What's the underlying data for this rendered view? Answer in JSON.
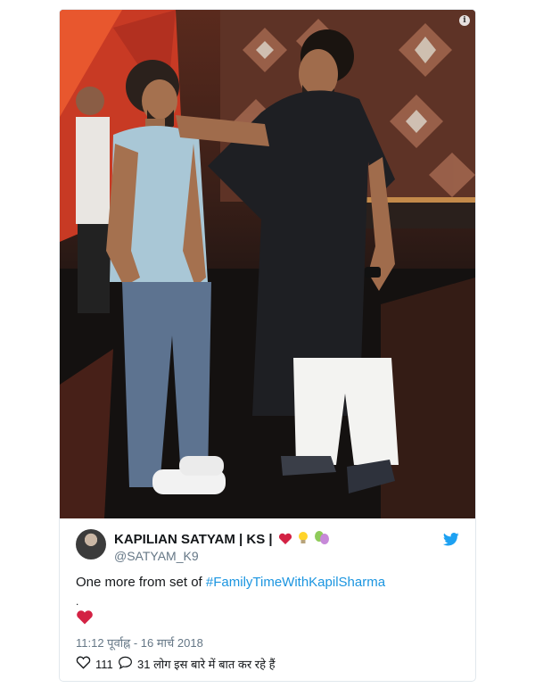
{
  "tweet": {
    "author_name": "KAPILIAN SATYAM | KS |",
    "author_handle": "@SATYAM_K9",
    "text_prefix": "One more from set of ",
    "hashtag": "#FamilyTimeWithKapilSharma",
    "extra_line": ".",
    "timestamp": "11:12 पूर्वाह्न - 16 मार्च 2018",
    "likes": "111",
    "replies_text": "31 लोग इस बारे में बात कर रहे हैं"
  },
  "icons": {
    "info": "info-icon",
    "bird": "twitter-bird-icon",
    "heart": "heart-icon",
    "reply": "reply-icon",
    "bulb": "lightbulb-emoji",
    "masks": "theater-masks-emoji"
  },
  "colors": {
    "link": "#1b95e0",
    "heart": "#e0245e",
    "muted": "#657786"
  }
}
